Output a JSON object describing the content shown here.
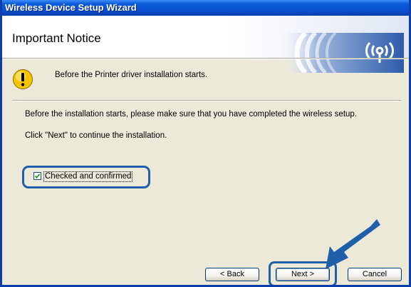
{
  "window": {
    "title": "Wireless Device Setup Wizard"
  },
  "header": {
    "title": "Important Notice",
    "logo_icon": "wireless-signal-icon"
  },
  "notice": {
    "icon": "warning-icon",
    "text": "Before the Printer driver installation starts."
  },
  "body": {
    "line1": "Before the installation starts, please make sure that you have completed the wireless setup.",
    "line2": "Click \"Next\" to continue the installation."
  },
  "confirm": {
    "label": "Checked and confirmed",
    "checked": true
  },
  "buttons": {
    "back": "< Back",
    "next": "Next >",
    "cancel": "Cancel"
  },
  "colors": {
    "titlebar": "#0b5bd8",
    "highlight": "#1f5fa8",
    "dialog_bg": "#ece9d8",
    "warning": "#f5c400"
  }
}
